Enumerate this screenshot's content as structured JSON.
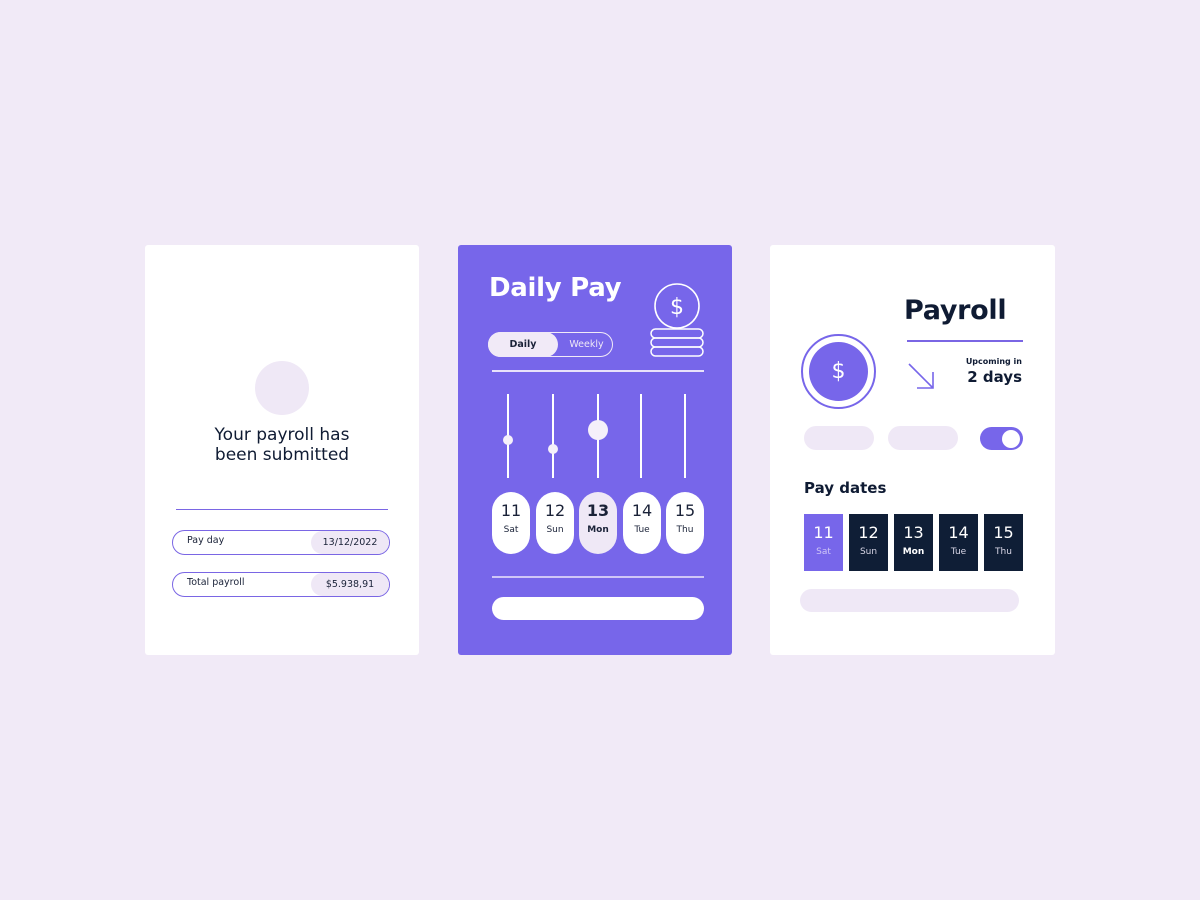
{
  "colors": {
    "background": "#f1eaf7",
    "accent": "#7766ea",
    "navy": "#0f1e36",
    "lavender": "#efe8f6"
  },
  "submitted_card": {
    "avatar_icon": "avatar-placeholder",
    "title_line1": "Your payroll has",
    "title_line2": "been submitted",
    "rows": [
      {
        "label": "Pay day",
        "value": "13/12/2022"
      },
      {
        "label": "Total payroll",
        "value": "$5.938,91"
      }
    ]
  },
  "daily_card": {
    "title": "Daily Pay",
    "icon": "coin-stack-icon",
    "toggle": {
      "options": [
        "Daily",
        "Weekly"
      ],
      "selected": "Daily"
    },
    "slider_levels": [
      0.55,
      0.65,
      0.43,
      null,
      null
    ],
    "days": [
      {
        "num": "11",
        "dow": "Sat",
        "active": false
      },
      {
        "num": "12",
        "dow": "Sun",
        "active": false
      },
      {
        "num": "13",
        "dow": "Mon",
        "active": true
      },
      {
        "num": "14",
        "dow": "Tue",
        "active": false
      },
      {
        "num": "15",
        "dow": "Thu",
        "active": false
      }
    ]
  },
  "payroll_card": {
    "title": "Payroll",
    "coin_symbol": "$",
    "arrow_icon": "arrow-down-right-icon",
    "upcoming_label": "Upcoming in",
    "upcoming_value": "2 days",
    "switch_on": true,
    "pay_dates_label": "Pay dates",
    "dates": [
      {
        "num": "11",
        "dow": "Sat",
        "selected": true
      },
      {
        "num": "12",
        "dow": "Sun",
        "selected": false
      },
      {
        "num": "13",
        "dow": "Mon",
        "selected": false,
        "bold": true
      },
      {
        "num": "14",
        "dow": "Tue",
        "selected": false
      },
      {
        "num": "15",
        "dow": "Thu",
        "selected": false
      }
    ]
  }
}
